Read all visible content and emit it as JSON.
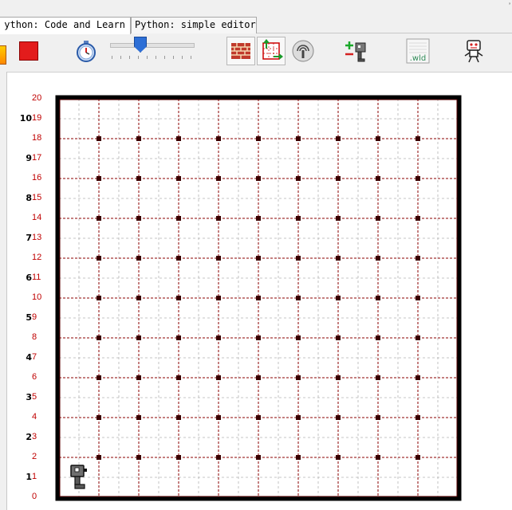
{
  "tabs": [
    {
      "label": "ython: Code and Learn",
      "active": true
    },
    {
      "label": "Python: simple editor",
      "active": false
    }
  ],
  "corner_mark": "’",
  "toolbar": {
    "buttons": [
      {
        "icon": "step-icon"
      },
      {
        "icon": "stop-icon"
      },
      {
        "icon": "stopwatch-icon"
      },
      {
        "icon": "wall-brick-icon"
      },
      {
        "icon": "world-resize-icon"
      },
      {
        "icon": "beacon-icon"
      },
      {
        "icon": "add-remove-robot-icon"
      },
      {
        "icon": "world-file-icon",
        "label": ".wld"
      },
      {
        "icon": "robot-color-icon"
      }
    ],
    "speed_slider": {
      "value": 0.35
    }
  },
  "world": {
    "avenue_labels": [
      "10",
      "9",
      "8",
      "7",
      "6",
      "5",
      "4",
      "3",
      "2",
      "1"
    ],
    "street_labels": [
      "20",
      "19",
      "18",
      "17",
      "16",
      "15",
      "14",
      "13",
      "12",
      "11",
      "10",
      "9",
      "8",
      "7",
      "6",
      "5",
      "4",
      "3",
      "2",
      "1",
      "0"
    ],
    "grid_size": 10,
    "beeper_rows": 9,
    "beeper_cols": 9,
    "robot": {
      "avenue": 1,
      "street": 1,
      "facing": "east"
    },
    "colors": {
      "wall": "#000000",
      "wall_inner": "#5a0000",
      "street_line": "#8b0000",
      "minor_line": "#b4b4b4",
      "beeper": "#3a0000",
      "street_label": "#c00000"
    }
  }
}
